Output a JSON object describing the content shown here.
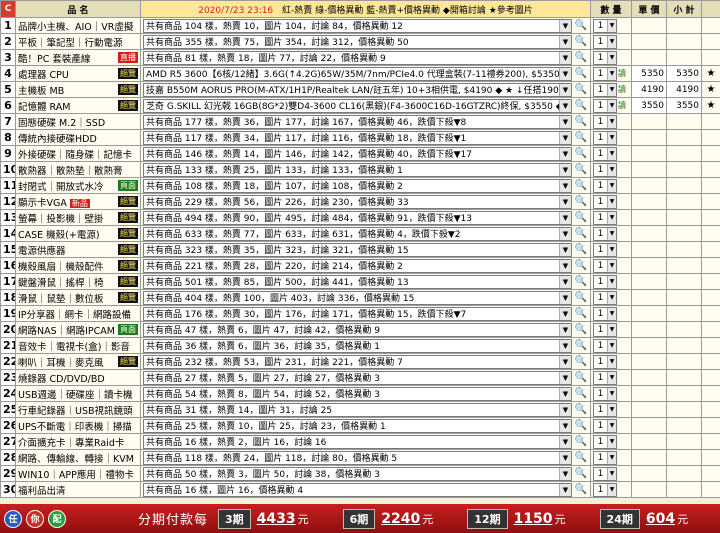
{
  "header": {
    "corner": "C",
    "name_col": "品 名",
    "info_date": "2020/7/23 23:16",
    "info_legend": "紅-熱賣 綠-價格異動 藍-熱賣+價格異動 ◆開箱討論 ★參考圖片",
    "qty_col": "數 量",
    "price_col": "單 價",
    "subtotal_col": "小 計"
  },
  "rows": [
    {
      "no": "1",
      "name": "品牌小主機、AIO｜VR虛擬",
      "badge": "",
      "desc": "共有商品 104 樣，熱賣 10，圖片 104，討論 84，價格異動 12",
      "qty": "1",
      "price": "",
      "subtotal": "",
      "star": ""
    },
    {
      "no": "2",
      "name": "平板｜筆記型｜行動電源",
      "badge": "",
      "desc": "共有商品 355 樣，熱賣 75，圖片 354，討論 312，價格異動 50",
      "qty": "1",
      "price": "",
      "subtotal": "",
      "star": ""
    },
    {
      "no": "3",
      "name": "酷！PC 套裝產線",
      "badge": "直播",
      "desc": "共有商品 81 樣，熱賣 18，圖片 77，討論 22，價格異動 9",
      "qty": "1",
      "price": "",
      "subtotal": "",
      "star": ""
    },
    {
      "no": "4",
      "name": "處理器 CPU",
      "badge": "絕覽",
      "desc": "AMD R5 3600【6核/12緒】3.6G(↑4.2G)65W/35M/7nm/PCIe4.0 代理盒裝(7-11禮券200), $5350 ◆ ★",
      "qty": "1",
      "qtag": "讀",
      "price": "5350",
      "subtotal": "5350",
      "star": "★"
    },
    {
      "no": "5",
      "name": "主機板 MB",
      "badge": "絕覽",
      "desc": "技嘉 B550M AORUS PRO(M-ATX/1H1P/Realtek LAN/註五年) 10+3相供電, $4190 ◆ ★ ↓任搭190↓",
      "qty": "1",
      "qtag": "讀",
      "price": "4190",
      "subtotal": "4190",
      "star": "★"
    },
    {
      "no": "6",
      "name": "記憶體 RAM",
      "badge": "絕覽",
      "desc": "芝奇 G.SKILL 幻光戟 16GB(8G*2)雙D4-3600 CL16(黑銀)(F4-3600C16D-16GTZRC)終保, $3550 ◆ ★",
      "qty": "1",
      "qtag": "讀",
      "price": "3550",
      "subtotal": "3550",
      "star": "★"
    },
    {
      "no": "7",
      "name": "固態硬碟 M.2｜SSD",
      "badge": "",
      "desc": "共有商品 177 樣，熱賣 36，圖片 177，討論 167，價格異動 46，跌價下殺▼8",
      "qty": "1",
      "price": "",
      "subtotal": "",
      "star": ""
    },
    {
      "no": "8",
      "name": "傳統內接硬碟HDD",
      "badge": "",
      "desc": "共有商品 117 樣，熱賣 34，圖片 117，討論 116，價格異動 18，跌價下殺▼1",
      "qty": "1",
      "price": "",
      "subtotal": "",
      "star": ""
    },
    {
      "no": "9",
      "name": "外接硬碟｜隨身碟｜記憶卡",
      "badge": "",
      "desc": "共有商品 146 樣，熱賣 14，圖片 146，討論 142，價格異動 40，跌價下殺▼17",
      "qty": "1",
      "price": "",
      "subtotal": "",
      "star": ""
    },
    {
      "no": "10",
      "name": "散熱器｜散熱墊｜散熱膏",
      "badge": "",
      "desc": "共有商品 133 樣，熱賣 25，圖片 133，討論 133，價格異動 1",
      "qty": "1",
      "price": "",
      "subtotal": "",
      "star": ""
    },
    {
      "no": "11",
      "name": "封閉式｜開放式水冷",
      "badge": "頁面",
      "desc": "共有商品 108 樣，熱賣 18，圖片 107，討論 108，價格異動 2",
      "qty": "1",
      "price": "",
      "subtotal": "",
      "star": ""
    },
    {
      "no": "12",
      "name": "顯示卡VGA",
      "badge": "絕覽",
      "badge2": "新品",
      "desc": "共有商品 229 樣，熱賣 56，圖片 226，討論 230，價格異動 33",
      "qty": "1",
      "price": "",
      "subtotal": "",
      "star": ""
    },
    {
      "no": "13",
      "name": "螢幕｜投影機｜壁掛",
      "badge": "絕覽",
      "desc": "共有商品 494 樣，熱賣 90，圖片 495，討論 484，價格異動 91，跌價下殺▼13",
      "qty": "1",
      "price": "",
      "subtotal": "",
      "star": ""
    },
    {
      "no": "14",
      "name": "CASE 機殼(+電源)",
      "badge": "絕覽",
      "desc": "共有商品 633 樣，熱賣 77，圖片 633，討論 631，價格異動 4，跌價下殺▼2",
      "qty": "1",
      "price": "",
      "subtotal": "",
      "star": ""
    },
    {
      "no": "15",
      "name": "電源供應器",
      "badge": "絕覽",
      "desc": "共有商品 323 樣，熱賣 35，圖片 323，討論 321，價格異動 15",
      "qty": "1",
      "price": "",
      "subtotal": "",
      "star": ""
    },
    {
      "no": "16",
      "name": "機殼風扇｜機殼配件",
      "badge": "絕覽",
      "desc": "共有商品 221 樣，熱賣 28，圖片 220，討論 214，價格異動 2",
      "qty": "1",
      "price": "",
      "subtotal": "",
      "star": ""
    },
    {
      "no": "17",
      "name": "鍵盤滑鼠｜搖桿｜椅",
      "badge": "絕覽",
      "desc": "共有商品 501 樣，熱賣 85，圖片 500，討論 441，價格異動 13",
      "qty": "1",
      "price": "",
      "subtotal": "",
      "star": ""
    },
    {
      "no": "18",
      "name": "滑鼠｜鼠墊｜數位板",
      "badge": "絕覽",
      "desc": "共有商品 404 樣，熱賣 100，圖片 403，討論 336，價格異動 15",
      "qty": "1",
      "price": "",
      "subtotal": "",
      "star": ""
    },
    {
      "no": "19",
      "name": "IP分享器｜網卡｜網路設備",
      "badge": "",
      "desc": "共有商品 176 樣，熱賣 30，圖片 176，討論 171，價格異動 15，跌價下殺▼7",
      "qty": "1",
      "price": "",
      "subtotal": "",
      "star": ""
    },
    {
      "no": "20",
      "name": "網路NAS｜網路IPCAM",
      "badge": "頁面",
      "desc": "共有商品 47 樣，熱賣 6，圖片 47，討論 42，價格異動 9",
      "qty": "1",
      "price": "",
      "subtotal": "",
      "star": ""
    },
    {
      "no": "21",
      "name": "音效卡｜電視卡(盒)｜影音",
      "badge": "",
      "desc": "共有商品 36 樣，熱賣 6，圖片 36，討論 35，價格異動 1",
      "qty": "1",
      "price": "",
      "subtotal": "",
      "star": ""
    },
    {
      "no": "22",
      "name": "喇叭｜耳機｜麥克風",
      "badge": "絕覽",
      "desc": "共有商品 232 樣，熱賣 53，圖片 231，討論 221，價格異動 7",
      "qty": "1",
      "price": "",
      "subtotal": "",
      "star": ""
    },
    {
      "no": "23",
      "name": "燒錄器 CD/DVD/BD",
      "badge": "",
      "desc": "共有商品 27 樣，熱賣 5，圖片 27，討論 27，價格異動 3",
      "qty": "1",
      "price": "",
      "subtotal": "",
      "star": ""
    },
    {
      "no": "24",
      "name": "USB週邊｜硬碟座｜讀卡機",
      "badge": "",
      "desc": "共有商品 54 樣，熱賣 8，圖片 54，討論 52，價格異動 3",
      "qty": "1",
      "price": "",
      "subtotal": "",
      "star": ""
    },
    {
      "no": "25",
      "name": "行車紀錄器｜USB視訊鏡頭",
      "badge": "",
      "desc": "共有商品 31 樣，熱賣 14，圖片 31，討論 25",
      "qty": "1",
      "price": "",
      "subtotal": "",
      "star": ""
    },
    {
      "no": "26",
      "name": "UPS不斷電｜印表機｜掃描",
      "badge": "",
      "desc": "共有商品 25 樣，熱賣 10，圖片 25，討論 23，價格異動 1",
      "qty": "1",
      "price": "",
      "subtotal": "",
      "star": ""
    },
    {
      "no": "27",
      "name": "介面擴充卡｜專業Raid卡",
      "badge": "",
      "desc": "共有商品 16 樣，熱賣 2，圖片 16，討論 16",
      "qty": "1",
      "price": "",
      "subtotal": "",
      "star": ""
    },
    {
      "no": "28",
      "name": "網路、傳輸線、轉接｜KVM",
      "badge": "",
      "desc": "共有商品 118 樣，熱賣 24，圖片 118，討論 80，價格異動 5",
      "qty": "1",
      "price": "",
      "subtotal": "",
      "star": ""
    },
    {
      "no": "29",
      "name": "WIN10｜APP應用｜禮物卡",
      "badge": "",
      "desc": "共有商品 50 樣，熱賣 3，圖片 50，討論 38，價格異動 3",
      "qty": "1",
      "price": "",
      "subtotal": "",
      "star": ""
    },
    {
      "no": "30",
      "name": "福利品出清",
      "badge": "",
      "desc": "共有商品 16 樣，圖片 16，價格異動 4",
      "qty": "1",
      "price": "",
      "subtotal": "",
      "star": ""
    }
  ],
  "footer": {
    "btn_any": "任",
    "btn_you": "你",
    "btn_pei": "配",
    "title": "分期付款每",
    "terms": [
      {
        "label": "3期",
        "amount": "4433",
        "unit": "元"
      },
      {
        "label": "6期",
        "amount": "2240",
        "unit": "元"
      },
      {
        "label": "12期",
        "amount": "1150",
        "unit": "元"
      },
      {
        "label": "24期",
        "amount": "604",
        "unit": "元"
      }
    ]
  },
  "colors": {
    "header_red": "#d93b30",
    "footer_red": "#c72020",
    "badge_black": "#111111",
    "badge_red": "#d61c1c",
    "badge_green": "#1f7a1f",
    "background": "#f3f1d8"
  },
  "icons": {
    "search": "magnifier-icon",
    "dropdown": "chevron-down-icon",
    "reference": "star-icon"
  }
}
